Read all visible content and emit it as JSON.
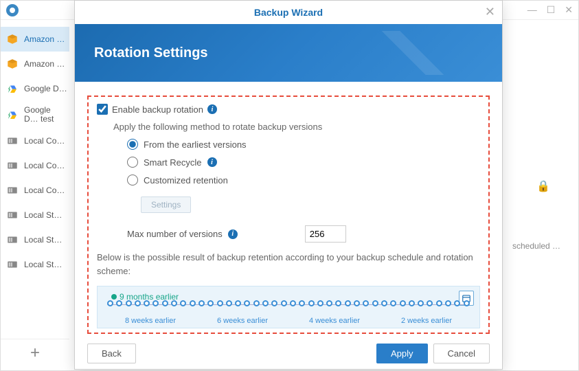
{
  "app": {
    "win_controls": {
      "min": "—",
      "max": "☐",
      "close": "✕"
    }
  },
  "sidebar": {
    "items": [
      {
        "label": "Amazon …",
        "icon": "amazon"
      },
      {
        "label": "Amazon …",
        "icon": "amazon"
      },
      {
        "label": "Google D…",
        "icon": "gdrive"
      },
      {
        "label": "Google D… test",
        "icon": "gdrive"
      },
      {
        "label": "Local Co…",
        "icon": "local"
      },
      {
        "label": "Local Co…",
        "icon": "local"
      },
      {
        "label": "Local Co…",
        "icon": "local"
      },
      {
        "label": "Local St…",
        "icon": "local"
      },
      {
        "label": "Local St…",
        "icon": "local"
      },
      {
        "label": "Local St…",
        "icon": "local"
      }
    ],
    "add": "+"
  },
  "rightPane": {
    "lock": "🔒",
    "scheduled": "scheduled …"
  },
  "modal": {
    "title": "Backup Wizard",
    "close": "✕",
    "banner": "Rotation Settings",
    "enable_label": "Enable backup rotation",
    "apply_text": "Apply the following method to rotate backup versions",
    "radios": {
      "earliest": "From the earliest versions",
      "smart": "Smart Recycle",
      "custom": "Customized retention"
    },
    "settings_btn": "Settings",
    "maxver_label": "Max number of versions",
    "maxver_value": "256",
    "desc": "Below is the possible result of backup retention according to your backup schedule and rotation scheme:",
    "timeline": {
      "top_label": "9 months earlier",
      "labels": [
        "8 weeks earlier",
        "6 weeks earlier",
        "4 weeks earlier",
        "2 weeks earlier"
      ]
    },
    "footer": {
      "back": "Back",
      "apply": "Apply",
      "cancel": "Cancel"
    }
  }
}
